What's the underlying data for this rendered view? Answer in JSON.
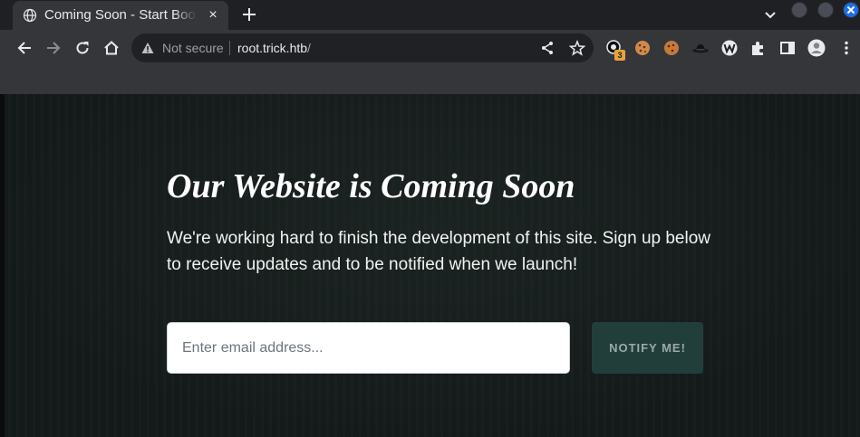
{
  "browser": {
    "tab": {
      "title": "Coming Soon - Start Bootstrap Theme",
      "icon": "globe-icon",
      "close": "×"
    },
    "toolbar": {
      "security_label": "Not secure",
      "url_host": "root.trick.htb",
      "url_path": "/"
    },
    "extensions": {
      "badge_count": "3"
    }
  },
  "page": {
    "headline": "Our Website is Coming Soon",
    "lead": "We're working hard to finish the development of this site. Sign up below to receive updates and to be notified when we launch!",
    "email_placeholder": "Enter email address...",
    "notify_label": "NOTIFY ME!"
  },
  "colors": {
    "page_background": "#151b1a",
    "button_background": "#223e3b",
    "button_text": "#9aaaa7",
    "close_window": "#1d6ee6"
  }
}
